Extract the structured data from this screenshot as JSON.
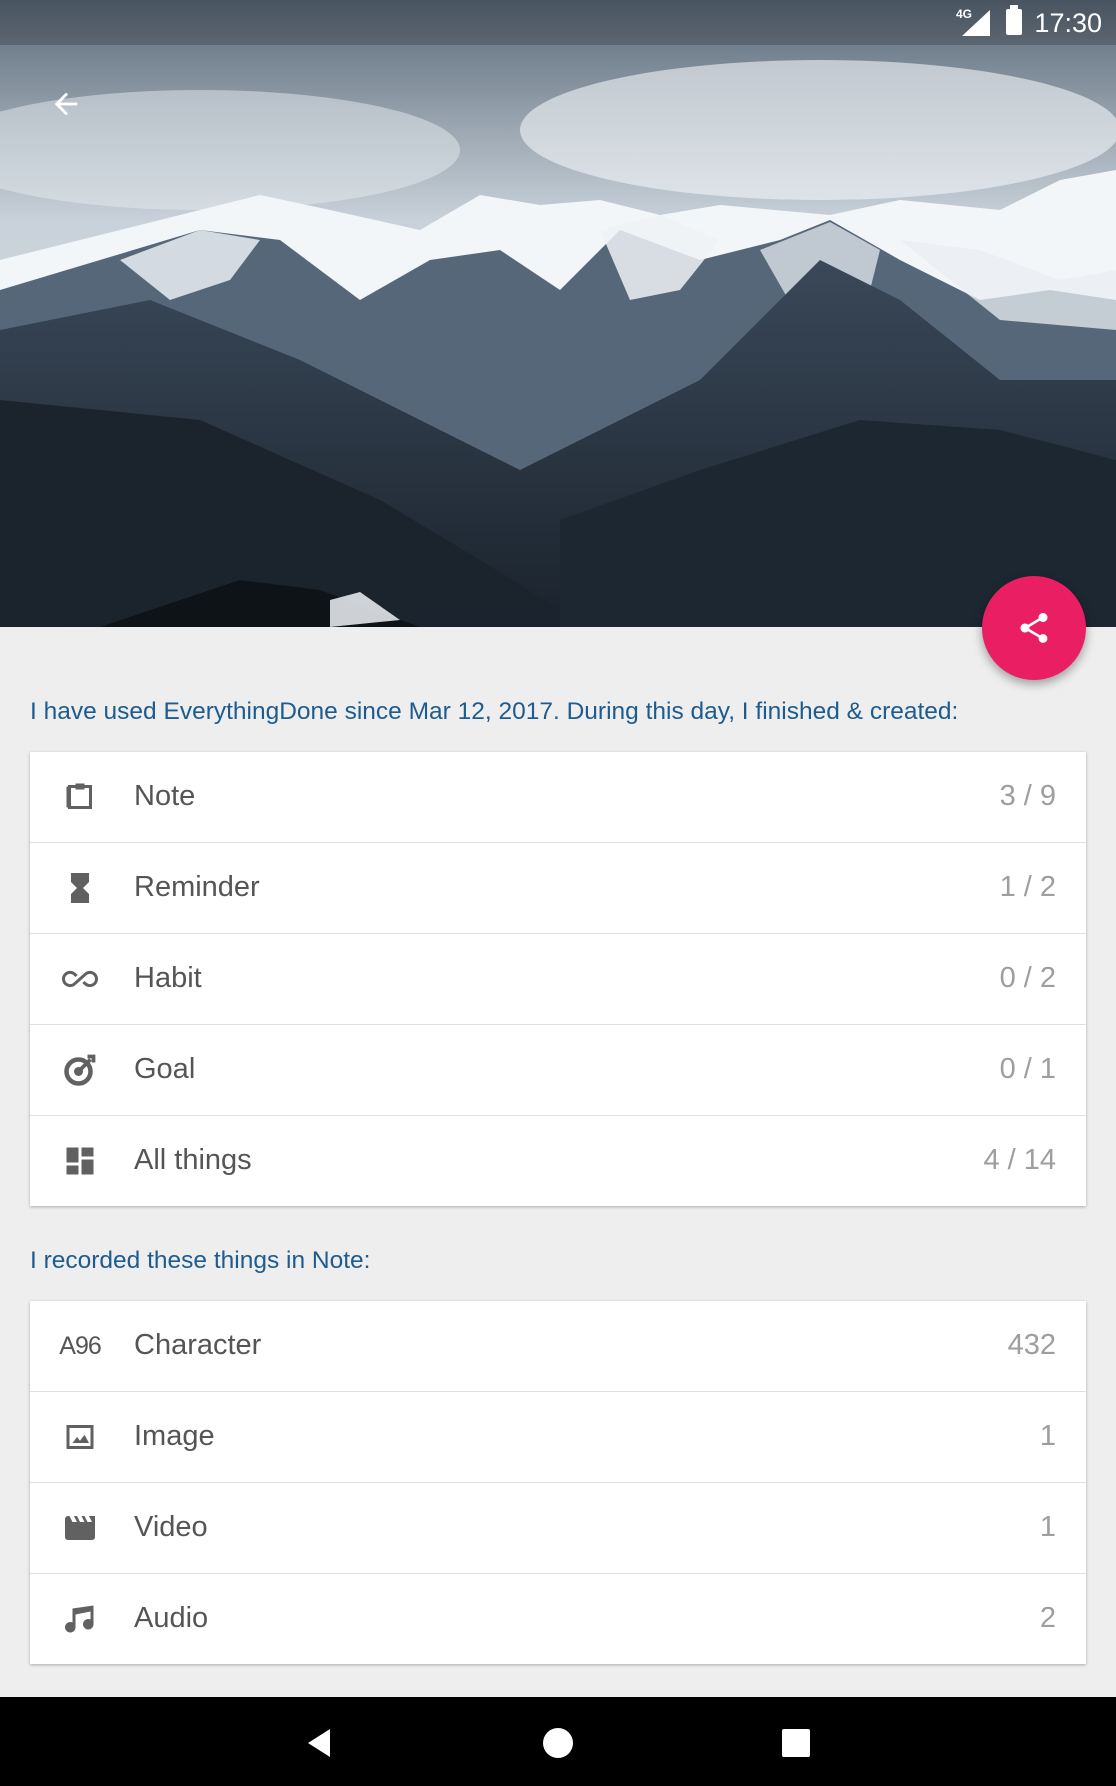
{
  "status_bar": {
    "network": "4G",
    "time": "17:30"
  },
  "header": {
    "back_icon": "arrow-back-icon",
    "share_icon": "share-icon",
    "fab_color": "#e91e63"
  },
  "summary": {
    "heading": "I have used EverythingDone since Mar 12, 2017. During this day, I finished & created:",
    "rows": [
      {
        "icon": "note-icon",
        "label": "Note",
        "value": "3 / 9"
      },
      {
        "icon": "hourglass-icon",
        "label": "Reminder",
        "value": "1 / 2"
      },
      {
        "icon": "habit-loop-icon",
        "label": "Habit",
        "value": "0 / 2"
      },
      {
        "icon": "target-icon",
        "label": "Goal",
        "value": "0 / 1"
      },
      {
        "icon": "dashboard-icon",
        "label": "All things",
        "value": "4 / 14"
      }
    ]
  },
  "note_stats": {
    "heading": "I recorded these things in Note:",
    "rows": [
      {
        "icon": "character-count-icon",
        "icon_text": "A96",
        "label": "Character",
        "value": "432"
      },
      {
        "icon": "image-icon",
        "label": "Image",
        "value": "1"
      },
      {
        "icon": "video-icon",
        "label": "Video",
        "value": "1"
      },
      {
        "icon": "music-note-icon",
        "label": "Audio",
        "value": "2"
      }
    ]
  },
  "colors": {
    "heading": "#1e5b8f",
    "background": "#eeeeee",
    "accent": "#e91e63"
  }
}
